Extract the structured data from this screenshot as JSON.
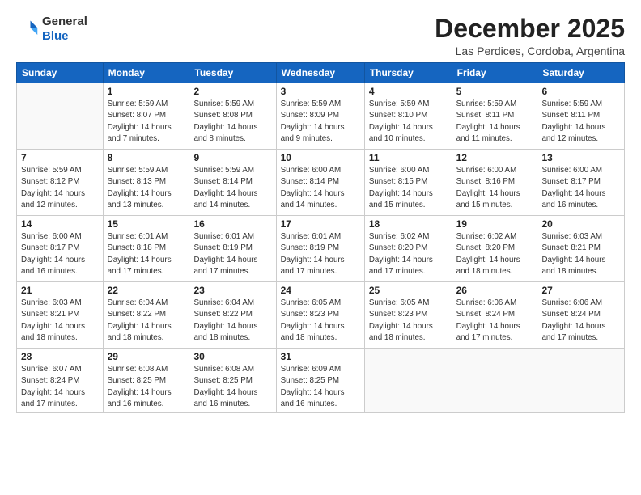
{
  "header": {
    "logo_line1": "General",
    "logo_line2": "Blue",
    "month_title": "December 2025",
    "location": "Las Perdices, Cordoba, Argentina"
  },
  "days_of_week": [
    "Sunday",
    "Monday",
    "Tuesday",
    "Wednesday",
    "Thursday",
    "Friday",
    "Saturday"
  ],
  "weeks": [
    [
      {
        "day": "",
        "info": ""
      },
      {
        "day": "1",
        "info": "Sunrise: 5:59 AM\nSunset: 8:07 PM\nDaylight: 14 hours\nand 7 minutes."
      },
      {
        "day": "2",
        "info": "Sunrise: 5:59 AM\nSunset: 8:08 PM\nDaylight: 14 hours\nand 8 minutes."
      },
      {
        "day": "3",
        "info": "Sunrise: 5:59 AM\nSunset: 8:09 PM\nDaylight: 14 hours\nand 9 minutes."
      },
      {
        "day": "4",
        "info": "Sunrise: 5:59 AM\nSunset: 8:10 PM\nDaylight: 14 hours\nand 10 minutes."
      },
      {
        "day": "5",
        "info": "Sunrise: 5:59 AM\nSunset: 8:11 PM\nDaylight: 14 hours\nand 11 minutes."
      },
      {
        "day": "6",
        "info": "Sunrise: 5:59 AM\nSunset: 8:11 PM\nDaylight: 14 hours\nand 12 minutes."
      }
    ],
    [
      {
        "day": "7",
        "info": "Sunrise: 5:59 AM\nSunset: 8:12 PM\nDaylight: 14 hours\nand 12 minutes."
      },
      {
        "day": "8",
        "info": "Sunrise: 5:59 AM\nSunset: 8:13 PM\nDaylight: 14 hours\nand 13 minutes."
      },
      {
        "day": "9",
        "info": "Sunrise: 5:59 AM\nSunset: 8:14 PM\nDaylight: 14 hours\nand 14 minutes."
      },
      {
        "day": "10",
        "info": "Sunrise: 6:00 AM\nSunset: 8:14 PM\nDaylight: 14 hours\nand 14 minutes."
      },
      {
        "day": "11",
        "info": "Sunrise: 6:00 AM\nSunset: 8:15 PM\nDaylight: 14 hours\nand 15 minutes."
      },
      {
        "day": "12",
        "info": "Sunrise: 6:00 AM\nSunset: 8:16 PM\nDaylight: 14 hours\nand 15 minutes."
      },
      {
        "day": "13",
        "info": "Sunrise: 6:00 AM\nSunset: 8:17 PM\nDaylight: 14 hours\nand 16 minutes."
      }
    ],
    [
      {
        "day": "14",
        "info": "Sunrise: 6:00 AM\nSunset: 8:17 PM\nDaylight: 14 hours\nand 16 minutes."
      },
      {
        "day": "15",
        "info": "Sunrise: 6:01 AM\nSunset: 8:18 PM\nDaylight: 14 hours\nand 17 minutes."
      },
      {
        "day": "16",
        "info": "Sunrise: 6:01 AM\nSunset: 8:19 PM\nDaylight: 14 hours\nand 17 minutes."
      },
      {
        "day": "17",
        "info": "Sunrise: 6:01 AM\nSunset: 8:19 PM\nDaylight: 14 hours\nand 17 minutes."
      },
      {
        "day": "18",
        "info": "Sunrise: 6:02 AM\nSunset: 8:20 PM\nDaylight: 14 hours\nand 17 minutes."
      },
      {
        "day": "19",
        "info": "Sunrise: 6:02 AM\nSunset: 8:20 PM\nDaylight: 14 hours\nand 18 minutes."
      },
      {
        "day": "20",
        "info": "Sunrise: 6:03 AM\nSunset: 8:21 PM\nDaylight: 14 hours\nand 18 minutes."
      }
    ],
    [
      {
        "day": "21",
        "info": "Sunrise: 6:03 AM\nSunset: 8:21 PM\nDaylight: 14 hours\nand 18 minutes."
      },
      {
        "day": "22",
        "info": "Sunrise: 6:04 AM\nSunset: 8:22 PM\nDaylight: 14 hours\nand 18 minutes."
      },
      {
        "day": "23",
        "info": "Sunrise: 6:04 AM\nSunset: 8:22 PM\nDaylight: 14 hours\nand 18 minutes."
      },
      {
        "day": "24",
        "info": "Sunrise: 6:05 AM\nSunset: 8:23 PM\nDaylight: 14 hours\nand 18 minutes."
      },
      {
        "day": "25",
        "info": "Sunrise: 6:05 AM\nSunset: 8:23 PM\nDaylight: 14 hours\nand 18 minutes."
      },
      {
        "day": "26",
        "info": "Sunrise: 6:06 AM\nSunset: 8:24 PM\nDaylight: 14 hours\nand 17 minutes."
      },
      {
        "day": "27",
        "info": "Sunrise: 6:06 AM\nSunset: 8:24 PM\nDaylight: 14 hours\nand 17 minutes."
      }
    ],
    [
      {
        "day": "28",
        "info": "Sunrise: 6:07 AM\nSunset: 8:24 PM\nDaylight: 14 hours\nand 17 minutes."
      },
      {
        "day": "29",
        "info": "Sunrise: 6:08 AM\nSunset: 8:25 PM\nDaylight: 14 hours\nand 16 minutes."
      },
      {
        "day": "30",
        "info": "Sunrise: 6:08 AM\nSunset: 8:25 PM\nDaylight: 14 hours\nand 16 minutes."
      },
      {
        "day": "31",
        "info": "Sunrise: 6:09 AM\nSunset: 8:25 PM\nDaylight: 14 hours\nand 16 minutes."
      },
      {
        "day": "",
        "info": ""
      },
      {
        "day": "",
        "info": ""
      },
      {
        "day": "",
        "info": ""
      }
    ]
  ]
}
